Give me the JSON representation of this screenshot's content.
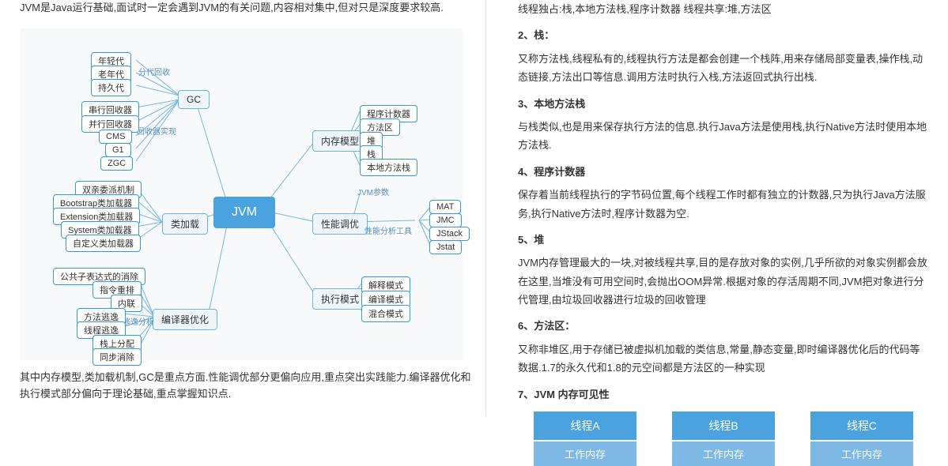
{
  "left": {
    "intro": "JVM是Java运行基础,面试时一定会遇到JVM的有关问题,内容相对集中,但对只是深度要求较高.",
    "intro2": "其中内存模型,类加载机制,GC是重点方面.性能调优部分更偏向应用,重点突出实践能力.编译器优化和执行模式部分偏向于理论基础,重点掌握知识点.",
    "center": "JVM",
    "majors": {
      "gc": "GC",
      "classload": "类加载",
      "compiler": "编译器优化",
      "mem": "内存模型",
      "perf": "性能调优",
      "exec": "执行模式"
    },
    "labels": {
      "gen_collect": "分代回收",
      "collector_impl": "回收器实现",
      "escape": "逃逸分析",
      "jvm_params": "JVM参数",
      "perf_tools": "性能分析工具"
    },
    "leaves": {
      "young": "年轻代",
      "old": "老年代",
      "perm": "持久代",
      "serial": "串行回收器",
      "parallel": "并行回收器",
      "cms": "CMS",
      "g1": "G1",
      "zgc": "ZGC",
      "parent": "双亲委派机制",
      "boot": "Bootstrap类加载器",
      "ext": "Extension类加载器",
      "sys": "System类加载器",
      "custom": "自定义类加载器",
      "subexpr": "公共子表达式的消除",
      "reorder": "指令重排",
      "inline": "内联",
      "method_esc": "方法逃逸",
      "thread_esc": "线程逃逸",
      "stackalloc": "栈上分配",
      "sync_elim": "同步消除",
      "pc": "程序计数器",
      "method_area": "方法区",
      "heap": "堆",
      "stack": "栈",
      "native_stack": "本地方法栈",
      "mat": "MAT",
      "jmc": "JMC",
      "jstack": "JStack",
      "jstat": "Jstat",
      "interpret": "解释模式",
      "compile": "编译模式",
      "mixed": "混合模式"
    }
  },
  "right": {
    "l0": "线程独占:栈,本地方法栈,程序计数器 线程共享:堆,方法区",
    "t2": "2、栈：",
    "p2": "又称方法栈,线程私有的,线程执行方法是都会创建一个栈阵,用来存储局部变量表,操作栈,动态链接,方法出口等信息.调用方法时执行入栈,方法返回式执行出栈.",
    "t3": "3、本地方法栈",
    "p3": "与栈类似,也是用来保存执行方法的信息.执行Java方法是使用栈,执行Native方法时使用本地方法栈.",
    "t4": "4、程序计数器",
    "p4": "保存着当前线程执行的字节码位置,每个线程工作时都有独立的计数器,只为执行Java方法服务,执行Native方法时,程序计数器为空.",
    "t5": "5、堆",
    "p5": "JVM内存管理最大的一块,对被线程共享,目的是存放对象的实例,几乎所欲的对象实例都会放在这里,当堆没有可用空间时,会抛出OOM异常.根据对象的存活周期不同,JVM把对象进行分代管理,由垃圾回收器进行垃圾的回收管理",
    "t6": "6、方法区：",
    "p6": "又称非堆区,用于存储已被虚拟机加载的类信息,常量,静态变量,即时编译器优化后的代码等数据.1.7的永久代和1.8的元空间都是方法区的一种实现",
    "t7": "7、JVM 内存可见性",
    "threads": {
      "a": {
        "title": "线程A",
        "sub": "工作内存"
      },
      "b": {
        "title": "线程B",
        "sub": "工作内存"
      },
      "c": {
        "title": "线程C",
        "sub": "工作内存"
      }
    }
  }
}
